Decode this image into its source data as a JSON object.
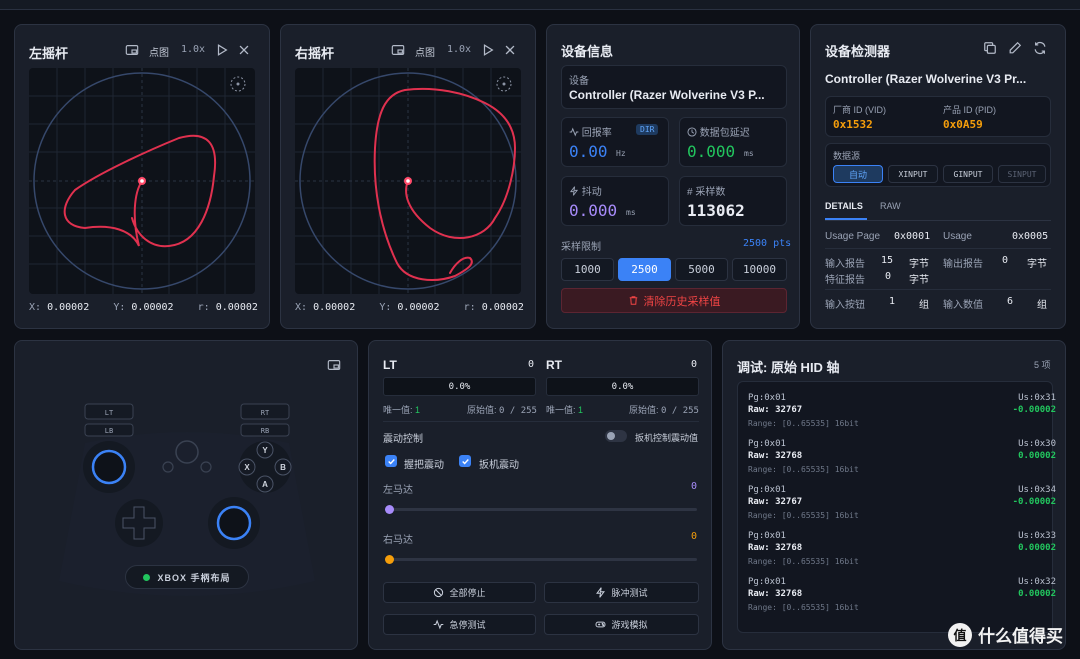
{
  "left_stick": {
    "title": "左摇杆",
    "mode": "点图",
    "zoom": "1.0x",
    "x_label": "X:",
    "x": "0.00002",
    "y_label": "Y:",
    "y": "0.00002",
    "r_label": "r:",
    "r": "0.00002"
  },
  "right_stick": {
    "title": "右摇杆",
    "mode": "点图",
    "zoom": "1.0x",
    "x_label": "X:",
    "x": "0.00002",
    "y_label": "Y:",
    "y": "0.00002",
    "r_label": "r:",
    "r": "0.00002"
  },
  "device_info": {
    "title": "设备信息",
    "device_label": "设备",
    "device_name": "Controller (Razer Wolverine V3 P...",
    "polling_label": "回报率",
    "polling_badge": "DIR",
    "polling_value": "0.00",
    "polling_unit": "Hz",
    "latency_label": "数据包延迟",
    "latency_value": "0.000",
    "latency_unit": "ms",
    "jitter_label": "抖动",
    "jitter_value": "0.000",
    "jitter_unit": "ms",
    "samples_label": "采样数",
    "samples_value": "113062",
    "sample_limit_label": "采样限制",
    "sample_limit_value": "2500 pts",
    "limits": [
      "1000",
      "2500",
      "5000",
      "10000"
    ],
    "active_limit": "2500",
    "clear_label": "清除历史采样值"
  },
  "detector": {
    "title": "设备检测器",
    "device_name": "Controller (Razer Wolverine V3 Pr...",
    "vid_label": "厂商 ID (VID)",
    "vid_value": "0x1532",
    "pid_label": "产品 ID (PID)",
    "pid_value": "0x0A59",
    "source_label": "数据源",
    "sources": [
      "自动",
      "XINPUT",
      "GINPUT",
      "SINPUT"
    ],
    "tabs": [
      "DETAILS",
      "RAW"
    ],
    "usage_page_label": "Usage Page",
    "usage_page_value": "0x0001",
    "usage_label": "Usage",
    "usage_value": "0x0005",
    "input_report_label": "输入报告",
    "input_report_value": "15",
    "input_report_unit": "字节",
    "output_report_label": "输出报告",
    "output_report_value": "0",
    "output_report_unit": "字节",
    "feature_report_label": "特征报告",
    "feature_report_value": "0",
    "feature_report_unit": "字节",
    "input_buttons_label": "输入按钮",
    "input_buttons_value": "1",
    "input_buttons_unit": "组",
    "input_values_label": "输入数值",
    "input_values_value": "6",
    "input_values_unit": "组"
  },
  "layout_panel": {
    "lt": "LT",
    "lb": "LB",
    "rt": "RT",
    "rb": "RB",
    "y": "Y",
    "x": "X",
    "b": "B",
    "a": "A",
    "layout_label": "XBOX 手柄布局"
  },
  "triggers": {
    "lt_label": "LT",
    "lt_value": "0",
    "lt_pct": "0.0%",
    "lt_unique_label": "唯一值:",
    "lt_unique": "1",
    "lt_raw_label": "原始值:",
    "lt_raw": "0 / 255",
    "rt_label": "RT",
    "rt_value": "0",
    "rt_pct": "0.0%",
    "rt_unique_label": "唯一值:",
    "rt_unique": "1",
    "rt_raw_label": "原始值:",
    "rt_raw": "0 / 255",
    "vibration_label": "震动控制",
    "trigger_vibration_toggle_label": "扳机控制震动值",
    "grip_vibration_label": "握把震动",
    "trigger_vibration_label": "扳机震动",
    "left_motor_label": "左马达",
    "left_motor_value": "0",
    "right_motor_label": "右马达",
    "right_motor_value": "0",
    "stop_all_label": "全部停止",
    "pulse_test_label": "脉冲测试",
    "emergency_test_label": "急停测试",
    "game_sim_label": "游戏模拟"
  },
  "hid_debug": {
    "title": "调试: 原始 HID 轴",
    "count": "5 项",
    "items": [
      {
        "pg": "Pg:0x01",
        "raw": "Raw: 32767",
        "range": "Range: [0..65535] 16bit",
        "us": "Us:0x31",
        "value": "-0.00002",
        "color": "#22c55e"
      },
      {
        "pg": "Pg:0x01",
        "raw": "Raw: 32768",
        "range": "Range: [0..65535] 16bit",
        "us": "Us:0x30",
        "value": "0.00002",
        "color": "#22c55e"
      },
      {
        "pg": "Pg:0x01",
        "raw": "Raw: 32767",
        "range": "Range: [0..65535] 16bit",
        "us": "Us:0x34",
        "value": "-0.00002",
        "color": "#22c55e"
      },
      {
        "pg": "Pg:0x01",
        "raw": "Raw: 32768",
        "range": "Range: [0..65535] 16bit",
        "us": "Us:0x33",
        "value": "0.00002",
        "color": "#22c55e"
      },
      {
        "pg": "Pg:0x01",
        "raw": "Raw: 32768",
        "range": "Range: [0..65535] 16bit",
        "us": "Us:0x32",
        "value": "0.00002",
        "color": "#22c55e"
      }
    ]
  },
  "watermark": "什么值得买",
  "colors": {
    "accent": "#3b82f6",
    "trace": "#e0314f",
    "green": "#22c55e",
    "purple": "#a78bfa",
    "orange": "#f59e0b",
    "danger": "#ef4444"
  }
}
